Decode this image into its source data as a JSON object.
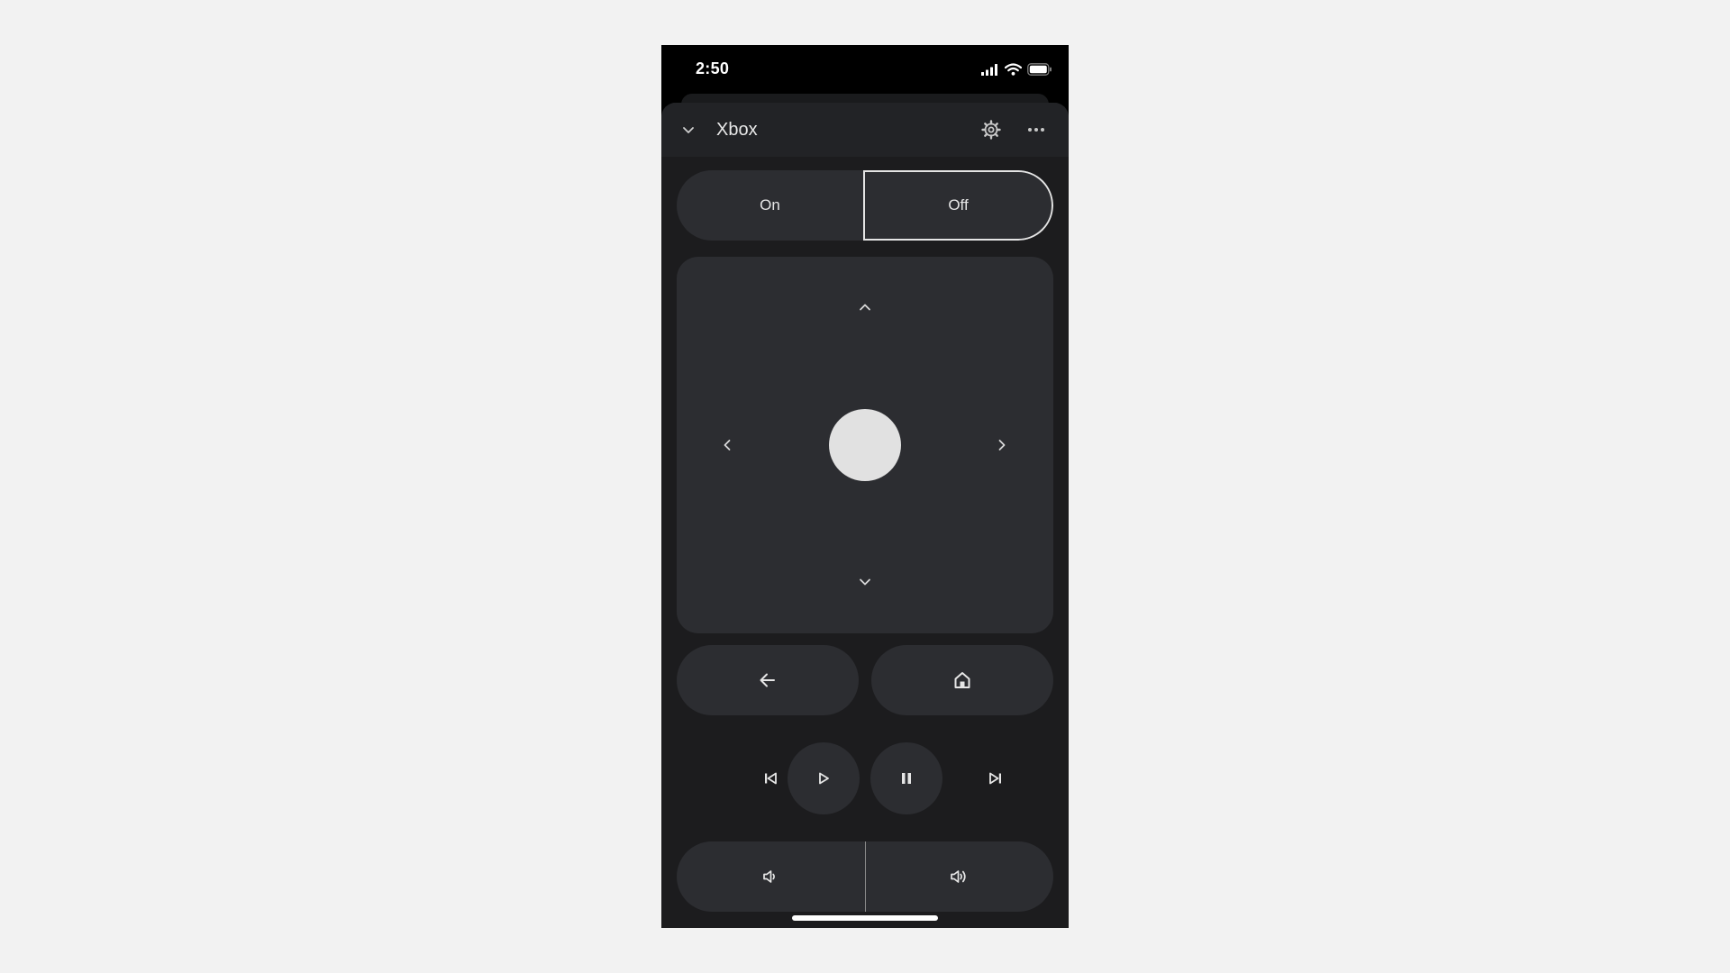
{
  "status_bar": {
    "time": "2:50",
    "icons": [
      "cellular-signal-icon",
      "wifi-icon",
      "battery-icon"
    ]
  },
  "header": {
    "title": "Xbox",
    "icons": [
      "chevron-down-icon",
      "gear-icon",
      "more-horizontal-icon"
    ]
  },
  "power": {
    "on_label": "On",
    "off_label": "Off",
    "selected": "Off"
  },
  "dpad": {
    "icons": [
      "chevron-up-icon",
      "chevron-left-icon",
      "chevron-right-icon",
      "chevron-down-icon"
    ]
  },
  "navigation": {
    "icons": [
      "arrow-back-icon",
      "home-icon"
    ]
  },
  "media": {
    "icons": [
      "skip-previous-icon",
      "play-icon",
      "pause-icon",
      "skip-next-icon"
    ]
  },
  "volume": {
    "icons": [
      "volume-down-icon",
      "volume-up-icon"
    ]
  },
  "colors": {
    "page_background": "#f2f2f2",
    "sheet_background": "#1c1c1e",
    "control_background": "#2c2d31",
    "ok_button": "#e1e1e1",
    "text": "#e6e6e6"
  }
}
